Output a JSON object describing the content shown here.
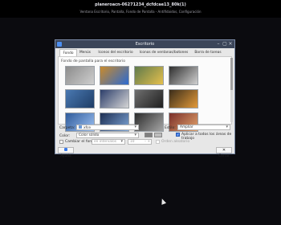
{
  "desktop": {
    "window_caption": "planeroacn-06271234_dcfdcae13_80k(1)",
    "window_subcaption": "Ventana Escritorio, Pantalla, Fondo de Pantalla - Antifidaidos, Configuración"
  },
  "dialog": {
    "title": "Escritorio",
    "tabs": [
      "Fondo",
      "Menús",
      "Iconos del escritorio",
      "Iconos de ventanas/botones",
      "Barra de tareas"
    ],
    "active_tab": "Fondo",
    "panel_subtitle": "Fondo de pantalla para el escritorio",
    "wallpapers": [
      {
        "name": "wallpaper-1",
        "colors": [
          "#8c8c8c",
          "#cfcfcf"
        ]
      },
      {
        "name": "wallpaper-2",
        "colors": [
          "#c98a2b",
          "#2b6ad1"
        ]
      },
      {
        "name": "wallpaper-3",
        "colors": [
          "#5f7a4c",
          "#e5c04d"
        ]
      },
      {
        "name": "wallpaper-4",
        "colors": [
          "#2f2f2f",
          "#d0d0d0"
        ]
      },
      {
        "name": "wallpaper-5",
        "colors": [
          "#4a79b2",
          "#1e3d66"
        ]
      },
      {
        "name": "wallpaper-6",
        "colors": [
          "#2c3e6b",
          "#d5d5d5"
        ]
      },
      {
        "name": "wallpaper-7",
        "colors": [
          "#6f6f6f",
          "#1f1f1f"
        ]
      },
      {
        "name": "wallpaper-8",
        "colors": [
          "#3a2d1a",
          "#e39a3a"
        ]
      },
      {
        "name": "wallpaper-9",
        "colors": [
          "#2f5b9b",
          "#9cc0f1"
        ]
      },
      {
        "name": "wallpaper-10",
        "colors": [
          "#1d2e52",
          "#7fa7d8"
        ]
      },
      {
        "name": "wallpaper-11",
        "colors": [
          "#2b2b2b",
          "#a6a6a6"
        ]
      },
      {
        "name": "wallpaper-12",
        "colors": [
          "#7a2f2a",
          "#e2a26b"
        ]
      }
    ],
    "folder_label": "Carpeta:",
    "folder_value": "xfce",
    "style_label": "Estilo:",
    "style_value": "Ampliar",
    "color_label": "Color:",
    "color_value": "Color sólido",
    "apply_all_label": "Aplicar a todos los áreas de trabajo",
    "change_bg_label": "Cambiar el fondo:",
    "interval_unit": "en intervalos",
    "interval_value": "10",
    "random_order_label": "Orden aleatorio",
    "help_button": "Ayuda",
    "close_button": "Cerrar"
  }
}
